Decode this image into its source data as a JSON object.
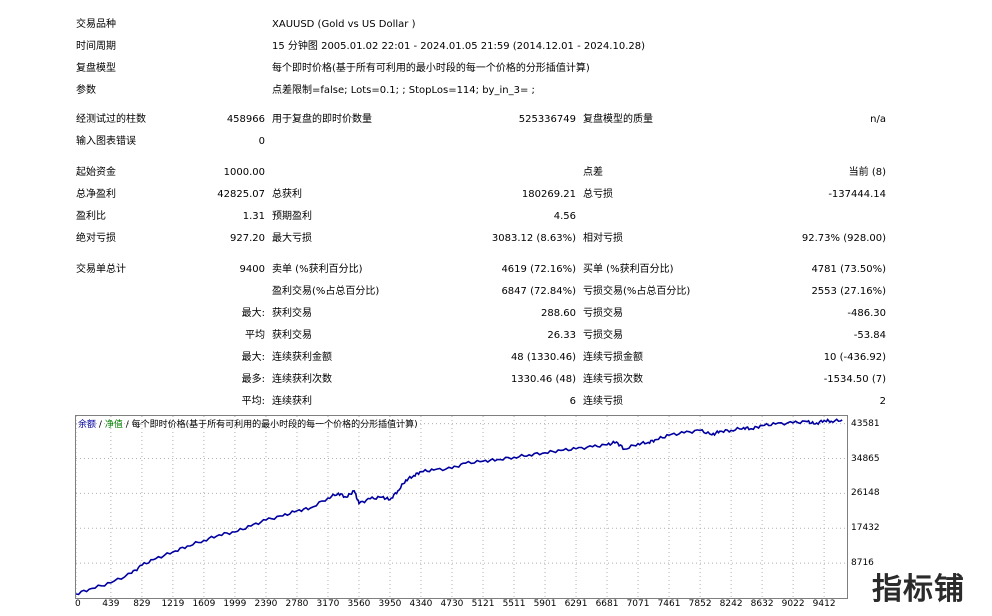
{
  "header": {
    "symbol_label": "交易品种",
    "symbol_value": "XAUUSD (Gold vs US Dollar )",
    "period_label": "时间周期",
    "period_value": "15 分钟图 2005.01.02 22:01 - 2024.01.05 21:59 (2014.12.01 - 2024.10.28)",
    "model_label": "复盘模型",
    "model_value": "每个即时价格(基于所有可利用的最小时段的每一个价格的分形插值计算)",
    "params_label": "参数",
    "params_value": "点差限制=false; Lots=0.1; ; StopLos=114; by_in_3= ;"
  },
  "bars": {
    "bars_label": "经测试过的柱数",
    "bars_value": "458966",
    "ticks_label": "用于复盘的即时价数量",
    "ticks_value": "525336749",
    "quality_label": "复盘模型的质量",
    "quality_value": "n/a",
    "errors_label": "输入图表错误",
    "errors_value": "0"
  },
  "stats": {
    "deposit_label": "起始资金",
    "deposit_value": "1000.00",
    "spread_label": "点差",
    "spread_value": "当前 (8)",
    "net_label": "总净盈利",
    "net_value": "42825.07",
    "gross_profit_label": "总获利",
    "gross_profit_value": "180269.21",
    "gross_loss_label": "总亏损",
    "gross_loss_value": "-137444.14",
    "pf_label": "盈利比",
    "pf_value": "1.31",
    "expected_label": "预期盈利",
    "expected_value": "4.56",
    "abs_dd_label": "绝对亏损",
    "abs_dd_value": "927.20",
    "max_dd_label": "最大亏损",
    "max_dd_value": "3083.12 (8.63%)",
    "rel_dd_label": "相对亏损",
    "rel_dd_value": "92.73% (928.00)"
  },
  "trades": {
    "total_label": "交易单总计",
    "total_value": "9400",
    "short_label": "卖单 (%获利百分比)",
    "short_value": "4619 (72.16%)",
    "long_label": "买单 (%获利百分比)",
    "long_value": "4781 (73.50%)",
    "profit_trades_label": "盈利交易(%占总百分比)",
    "profit_trades_value": "6847 (72.84%)",
    "loss_trades_label": "亏损交易(%占总百分比)",
    "loss_trades_value": "2553 (27.16%)",
    "max_prefix": "最大:",
    "avg_prefix": "平均",
    "max2_prefix": "最大:",
    "most_prefix": "最多:",
    "avg2_prefix": "平均:",
    "largest_profit_label": "获利交易",
    "largest_profit_value": "288.60",
    "largest_loss_label": "亏损交易",
    "largest_loss_value": "-486.30",
    "avg_profit_label": "获利交易",
    "avg_profit_value": "26.33",
    "avg_loss_label": "亏损交易",
    "avg_loss_value": "-53.84",
    "max_cons_wins_label": "连续获利金额",
    "max_cons_wins_value": "48 (1330.46)",
    "max_cons_losses_label": "连续亏损金额",
    "max_cons_losses_value": "10 (-436.92)",
    "max_cons_profit_label": "连续获利次数",
    "max_cons_profit_value": "1330.46 (48)",
    "max_cons_loss_label": "连续亏损次数",
    "max_cons_loss_value": "-1534.50 (7)",
    "avg_cons_wins_label": "连续获利",
    "avg_cons_wins_value": "6",
    "avg_cons_losses_label": "连续亏损",
    "avg_cons_losses_value": "2"
  },
  "chart_legend": {
    "balance": "余额",
    "sep1": "/",
    "equity": "净值",
    "sep2": "/",
    "model": "每个即时价格(基于所有可利用的最小时段的每一个价格的分形插值计算)"
  },
  "colors": {
    "balance": "#0000a0",
    "equity": "#008000"
  },
  "chart_data": {
    "type": "line",
    "title": "",
    "xlabel": "",
    "ylabel": "",
    "xlim": [
      0,
      9700
    ],
    "ylim": [
      0,
      45500
    ],
    "x_ticks": [
      "0",
      "439",
      "829",
      "1219",
      "1609",
      "1999",
      "2390",
      "2780",
      "3170",
      "3560",
      "3950",
      "4340",
      "4730",
      "5121",
      "5511",
      "5901",
      "6291",
      "6681",
      "7071",
      "7461",
      "7852",
      "8242",
      "8632",
      "9022",
      "9412"
    ],
    "y_ticks": [
      "43581",
      "34865",
      "26148",
      "17432",
      "8716"
    ],
    "series": [
      {
        "name": "余额",
        "x": [
          0,
          200,
          439,
          700,
          829,
          1000,
          1219,
          1400,
          1609,
          1800,
          1999,
          2200,
          2390,
          2600,
          2780,
          2950,
          3170,
          3300,
          3400,
          3500,
          3560,
          3700,
          3850,
          3950,
          4050,
          4150,
          4250,
          4340,
          4500,
          4730,
          4900,
          5121,
          5300,
          5511,
          5700,
          5901,
          6100,
          6291,
          6500,
          6681,
          6800,
          6900,
          7071,
          7200,
          7300,
          7461,
          7650,
          7852,
          8000,
          8100,
          8242,
          8400,
          8500,
          8632,
          8800,
          9022,
          9200,
          9300,
          9412,
          9500,
          9640
        ],
        "y": [
          1000,
          2400,
          3800,
          6200,
          8200,
          9800,
          11500,
          13000,
          14400,
          15800,
          16500,
          18000,
          19500,
          20500,
          21800,
          22500,
          25000,
          26200,
          25200,
          26800,
          23600,
          24800,
          25200,
          24600,
          26800,
          29500,
          30600,
          31600,
          32000,
          32400,
          33700,
          34200,
          34600,
          35200,
          35800,
          36300,
          36900,
          37300,
          37800,
          38300,
          39000,
          37200,
          38600,
          38900,
          39600,
          40700,
          41300,
          41900,
          40800,
          41700,
          41900,
          42600,
          42300,
          43100,
          43500,
          43800,
          44100,
          43500,
          44400,
          44200,
          44500
        ]
      }
    ]
  },
  "watermark": "指标铺"
}
